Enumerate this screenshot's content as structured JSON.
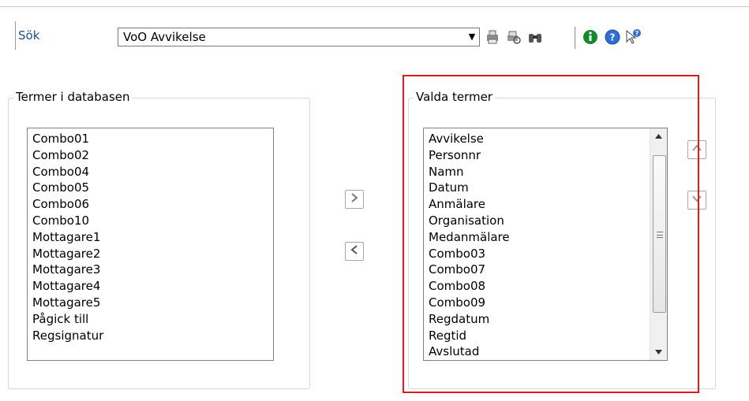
{
  "toolbar": {
    "search_label": "Sök",
    "combo_value": "VoO Avvikelse",
    "icons": [
      "printer-icon",
      "print-preview-icon",
      "binoculars-icon",
      "info-icon",
      "help-icon",
      "pointer-help-icon"
    ]
  },
  "left_panel": {
    "title": "Termer i databasen",
    "items": [
      "Combo01",
      "Combo02",
      "Combo04",
      "Combo05",
      "Combo06",
      "Combo10",
      "Mottagare1",
      "Mottagare2",
      "Mottagare3",
      "Mottagare4",
      "Mottagare5",
      "Pågick till",
      "Regsignatur"
    ]
  },
  "right_panel": {
    "title": "Valda termer",
    "items": [
      "Avvikelse",
      "Personnr",
      "Namn",
      "Datum",
      "Anmälare",
      "Organisation",
      "Medanmälare",
      "Combo03",
      "Combo07",
      "Combo08",
      "Combo09",
      "Regdatum",
      "Regtid",
      "Avslutad"
    ]
  },
  "colors": {
    "highlight_border": "#e21a1a",
    "link": "#1f4e9a",
    "info_green": "#138a2b",
    "help_blue": "#2c6fd6"
  }
}
